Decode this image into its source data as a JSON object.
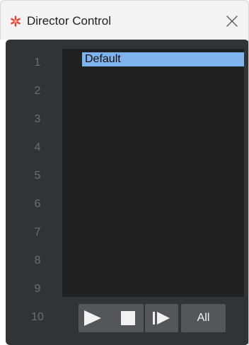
{
  "window": {
    "title": "Director Control",
    "app_icon": "red-asterisk-icon",
    "close_icon": "close-icon"
  },
  "rows": {
    "numbers": [
      "1",
      "2",
      "3",
      "4",
      "5",
      "6",
      "7",
      "8",
      "9",
      "10"
    ]
  },
  "list": {
    "items": [
      {
        "label": "Default",
        "selected": true
      }
    ]
  },
  "controls": {
    "play_icon": "play-icon",
    "stop_icon": "stop-icon",
    "step_icon": "step-forward-icon",
    "all_label": "All"
  },
  "colors": {
    "selection": "#7fb3ee",
    "panel": "#313437",
    "list_background": "#1f2123",
    "accent_icon": "#e8412c"
  }
}
